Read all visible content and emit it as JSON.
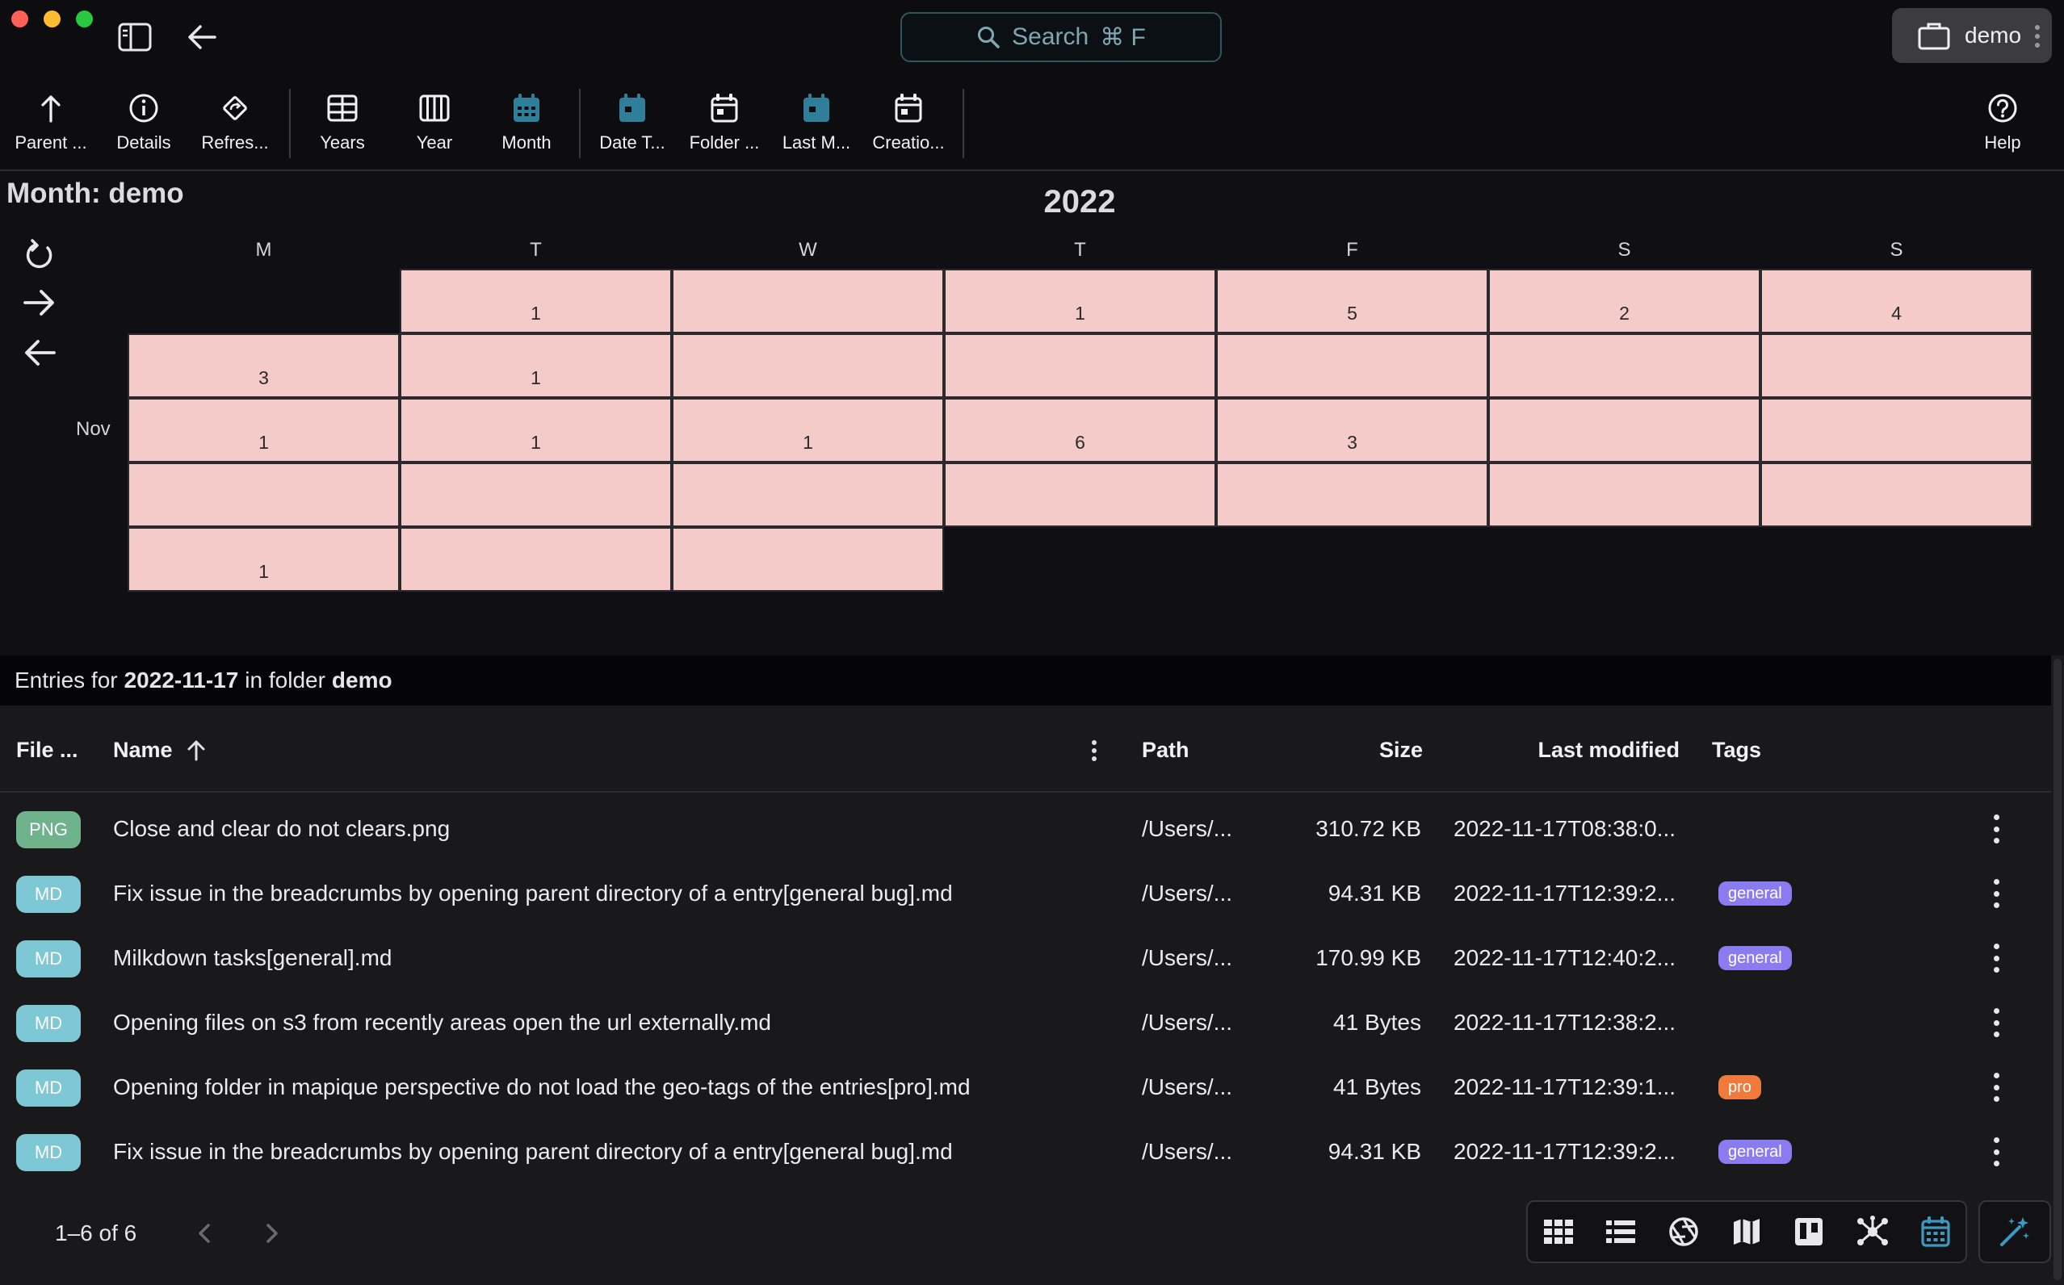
{
  "window": {
    "search_label": "Search",
    "search_shortcut": "⌘ F",
    "location_name": "demo",
    "traffic_colors": [
      "#fe5f57",
      "#febc2e",
      "#28c840"
    ]
  },
  "toolbar": {
    "parent": "Parent ...",
    "details": "Details",
    "refresh": "Refres...",
    "years": "Years",
    "year": "Year",
    "month": "Month",
    "date_taken": "Date T...",
    "folder": "Folder ...",
    "last_modified": "Last M...",
    "creation": "Creatio...",
    "help": "Help"
  },
  "calendar": {
    "title": "Month: demo",
    "year": "2022",
    "weekdays": [
      "M",
      "T",
      "W",
      "T",
      "F",
      "S",
      "S"
    ],
    "month_label": "Nov",
    "cell_color": "#f4cbc8",
    "weeks": [
      [
        "",
        "1",
        "",
        "1",
        "5",
        "2",
        "4"
      ],
      [
        "3",
        "1",
        "",
        "",
        "",
        "",
        ""
      ],
      [
        "1",
        "1",
        "1",
        "6",
        "3",
        "",
        ""
      ],
      [
        "",
        "",
        "",
        "",
        "",
        "",
        ""
      ],
      [
        "1",
        "",
        ""
      ]
    ]
  },
  "entries": {
    "prefix": "Entries for",
    "date": "2022-11-17",
    "middle": "in folder",
    "folder": "demo",
    "columns": {
      "file_type": "File ...",
      "name": "Name",
      "path": "Path",
      "size": "Size",
      "last_modified": "Last modified",
      "tags": "Tags"
    },
    "rows": [
      {
        "type": "PNG",
        "name": "Close and clear do not clears.png",
        "path": "/Users/...",
        "size": "310.72 KB",
        "modified": "2022-11-17T08:38:0...",
        "tag": ""
      },
      {
        "type": "MD",
        "name": "Fix issue in the breadcrumbs by opening parent directory of a entry[general bug].md",
        "path": "/Users/...",
        "size": "94.31 KB",
        "modified": "2022-11-17T12:39:2...",
        "tag": "general"
      },
      {
        "type": "MD",
        "name": "Milkdown tasks[general].md",
        "path": "/Users/...",
        "size": "170.99 KB",
        "modified": "2022-11-17T12:40:2...",
        "tag": "general"
      },
      {
        "type": "MD",
        "name": "Opening files on s3 from recently areas open the url externally.md",
        "path": "/Users/...",
        "size": "41 Bytes",
        "modified": "2022-11-17T12:38:2...",
        "tag": ""
      },
      {
        "type": "MD",
        "name": "Opening folder in mapique perspective do not load the geo-tags of the entries[pro].md",
        "path": "/Users/...",
        "size": "41 Bytes",
        "modified": "2022-11-17T12:39:1...",
        "tag": "pro"
      },
      {
        "type": "MD",
        "name": "Fix issue in the breadcrumbs by opening parent directory of a entry[general bug].md",
        "path": "/Users/...",
        "size": "94.31 KB",
        "modified": "2022-11-17T12:39:2...",
        "tag": "general"
      }
    ],
    "badge_colors": {
      "PNG": "#6fb38d",
      "MD": "#7ec8d6"
    },
    "tag_colors": {
      "general": "#8a7cf0",
      "pro": "#f07a3c"
    }
  },
  "footer": {
    "pagination": "1–6 of 6"
  },
  "perspectives": [
    "grid-icon",
    "list-icon",
    "gallery-icon",
    "map-icon",
    "kanban-icon",
    "graph-icon",
    "calendar-icon",
    "wand-icon"
  ]
}
